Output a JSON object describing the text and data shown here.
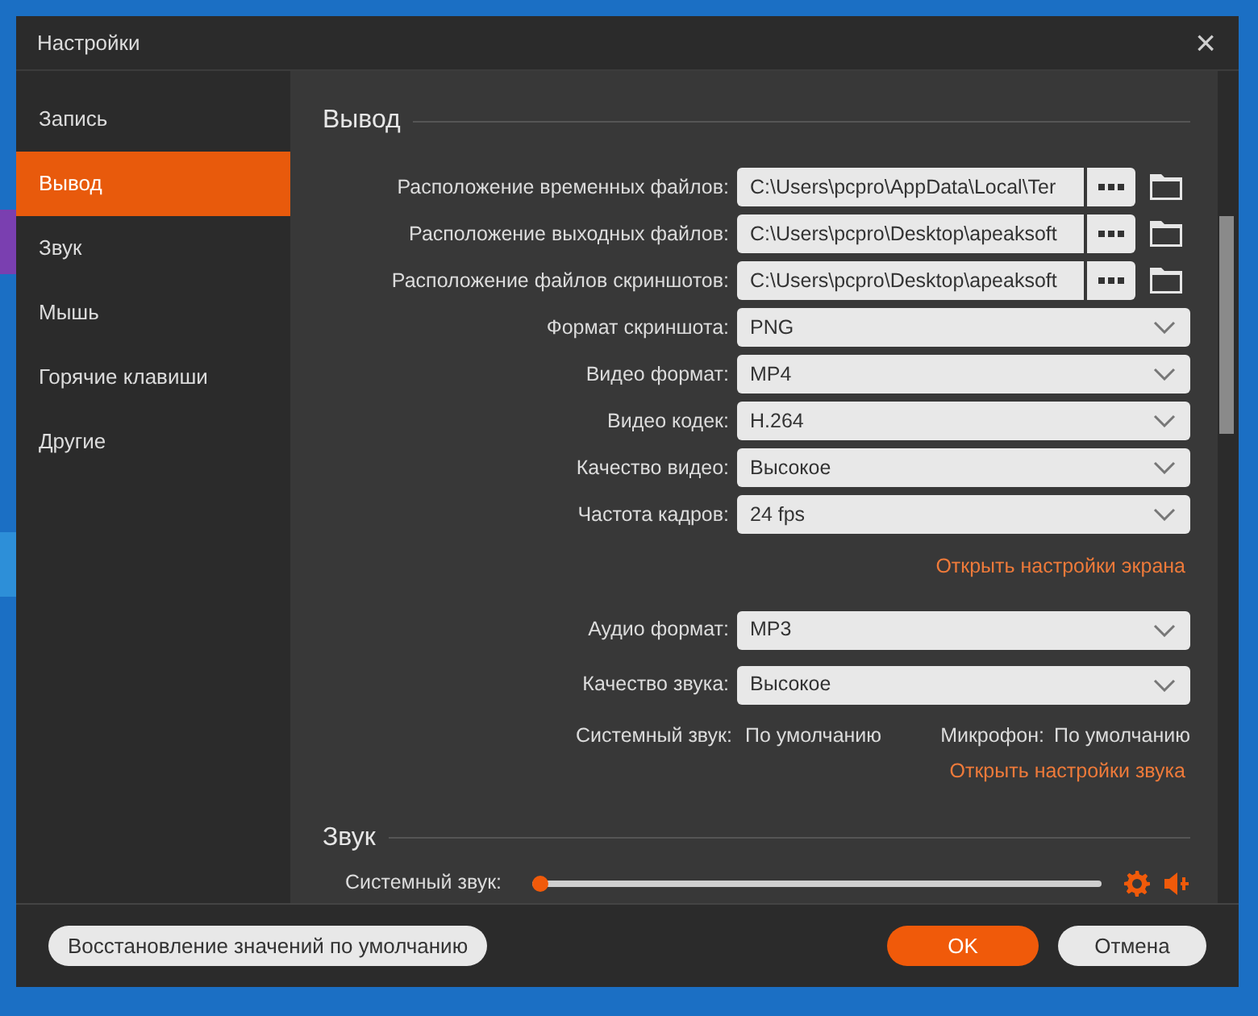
{
  "window": {
    "title": "Настройки",
    "close": "×"
  },
  "sidebar": {
    "items": [
      {
        "label": "Запись",
        "selected": false
      },
      {
        "label": "Вывод",
        "selected": true
      },
      {
        "label": "Звук",
        "selected": false
      },
      {
        "label": "Мышь",
        "selected": false
      },
      {
        "label": "Горячие клавиши",
        "selected": false
      },
      {
        "label": "Другие",
        "selected": false
      }
    ]
  },
  "output": {
    "heading": "Вывод",
    "path_rows": [
      {
        "label": "Расположение временных файлов:",
        "value": "C:\\Users\\pcpro\\AppData\\Local\\Ter"
      },
      {
        "label": "Расположение выходных файлов:",
        "value": "C:\\Users\\pcpro\\Desktop\\apeaksoft"
      },
      {
        "label": "Расположение файлов скриншотов:",
        "value": "C:\\Users\\pcpro\\Desktop\\apeaksoft"
      }
    ],
    "select_rows": [
      {
        "label": "Формат скриншота:",
        "value": "PNG"
      },
      {
        "label": "Видео формат:",
        "value": "MP4"
      },
      {
        "label": "Видео кодек:",
        "value": "H.264"
      },
      {
        "label": "Качество видео:",
        "value": "Высокое"
      },
      {
        "label": "Частота кадров:",
        "value": "24 fps"
      }
    ],
    "screen_link": "Открыть настройки экрана",
    "audio_rows": [
      {
        "label": "Аудио формат:",
        "value": "MP3"
      },
      {
        "label": "Качество звука:",
        "value": "Высокое"
      }
    ],
    "system_sound": {
      "label": "Системный звук:",
      "value": "По умолчанию"
    },
    "microphone": {
      "label": "Микрофон:",
      "value": "По умолчанию"
    },
    "sound_link": "Открыть настройки звука"
  },
  "sound": {
    "heading": "Звук",
    "slider": {
      "label": "Системный звук:",
      "level": 0
    }
  },
  "footer": {
    "reset_button": "Восстановление значений по умолчанию",
    "ok_button": "OK",
    "cancel_button": "Отмена"
  }
}
